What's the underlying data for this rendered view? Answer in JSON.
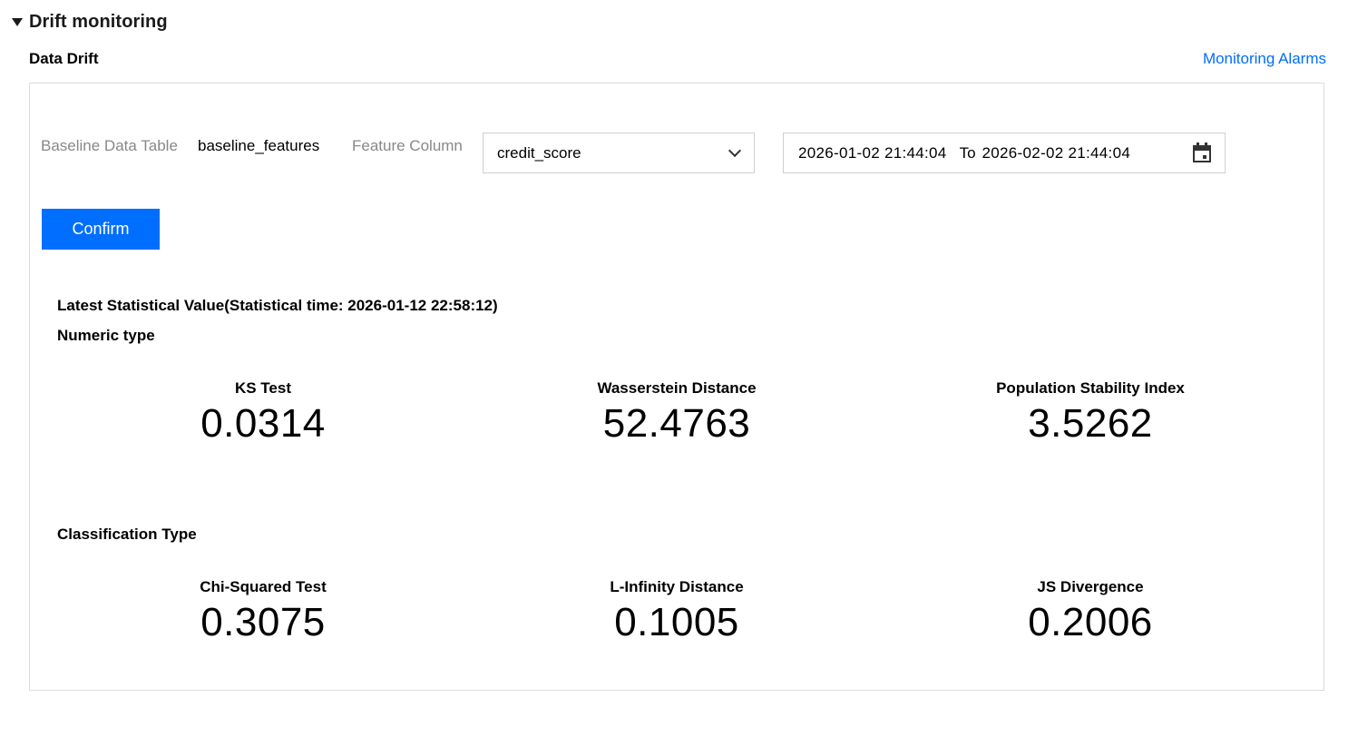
{
  "section": {
    "title": "Drift monitoring"
  },
  "subsection": {
    "title": "Data Drift",
    "link_label": "Monitoring Alarms"
  },
  "filters": {
    "baseline_label": "Baseline Data Table",
    "baseline_value": "baseline_features",
    "feature_label": "Feature Column",
    "feature_value": "credit_score",
    "date_start": "2026-01-02 21:44:04",
    "date_sep": "To",
    "date_end": "2026-02-02 21:44:04",
    "confirm_label": "Confirm"
  },
  "stats": {
    "title": "Latest Statistical Value(Statistical time: 2026-01-12 22:58:12)",
    "numeric": {
      "heading": "Numeric type",
      "metrics": [
        {
          "name": "KS Test",
          "value": "0.0314"
        },
        {
          "name": "Wasserstein Distance",
          "value": "52.4763"
        },
        {
          "name": "Population Stability Index",
          "value": "3.5262"
        }
      ]
    },
    "classification": {
      "heading": "Classification Type",
      "metrics": [
        {
          "name": "Chi-Squared Test",
          "value": "0.3075"
        },
        {
          "name": "L-Infinity Distance",
          "value": "0.1005"
        },
        {
          "name": "JS Divergence",
          "value": "0.2006"
        }
      ]
    }
  },
  "colors": {
    "accent": "#006eff",
    "border": "#dcdcdc",
    "muted_label": "#888888"
  },
  "icons": {
    "toggle": "caret-down-icon",
    "select": "chevron-down-icon",
    "date": "calendar-icon"
  }
}
